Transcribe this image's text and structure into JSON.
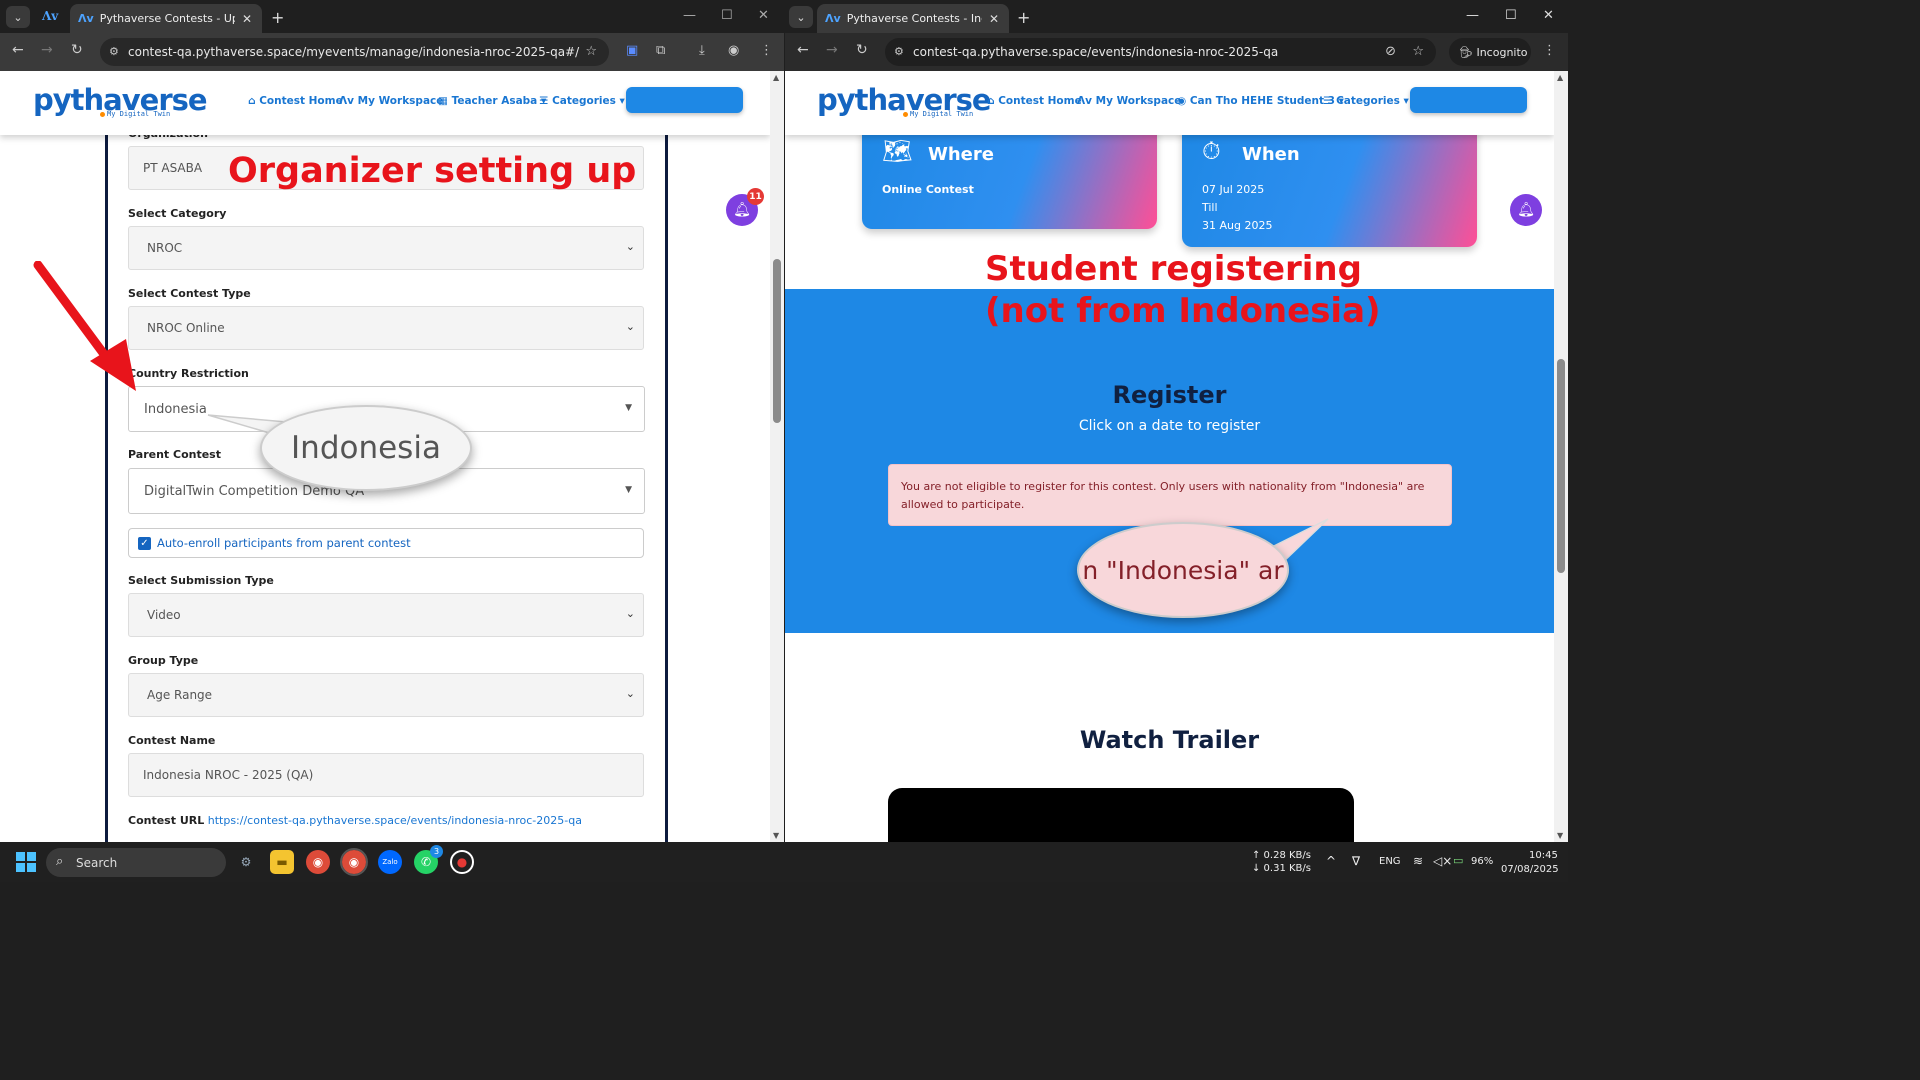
{
  "left_window": {
    "tab_title": "Pythaverse Contests - Update c",
    "url": "contest-qa.pythaverse.space/myevents/manage/indonesia-nroc-2025-qa#/",
    "header": {
      "logo": "pythaverse",
      "logo_sub": "My Digital Twin",
      "nav": [
        "Contest Home",
        "My Workspace",
        "Teacher Asaba",
        "Categories"
      ]
    },
    "notification_count": "11",
    "annotation_title": "Organizer setting up",
    "form": {
      "partial_top_label": "Organization",
      "organization_value": "PT ASABA",
      "category_label": "Select Category",
      "category_value": "NROC",
      "contest_type_label": "Select Contest Type",
      "contest_type_value": "NROC Online",
      "country_label": "Country Restriction",
      "country_value": "Indonesia",
      "country_zoom": "Indonesia",
      "parent_label": "Parent Contest",
      "parent_value": "DigitalTwin Competition Demo QA",
      "auto_enroll_label": "Auto-enroll participants from parent contest",
      "submission_label": "Select Submission Type",
      "submission_value": "Video",
      "group_label": "Group Type",
      "group_value": "Age Range",
      "name_label": "Contest Name",
      "name_value": "Indonesia NROC - 2025 (QA)",
      "url_label": "Contest URL",
      "url_value": "https://contest-qa.pythaverse.space/events/indonesia-nroc-2025-qa"
    }
  },
  "right_window": {
    "tab_title": "Pythaverse Contests - Indonesi",
    "url": "contest-qa.pythaverse.space/events/indonesia-nroc-2025-qa",
    "incognito_label": "Incognito",
    "header": {
      "logo": "pythaverse",
      "logo_sub": "My Digital Twin",
      "nav": [
        "Contest Home",
        "My Workspace",
        "Can Tho HEHE Student 3",
        "Categories"
      ]
    },
    "where_card": {
      "title": "Where",
      "value": "Online Contest"
    },
    "when_card": {
      "title": "When",
      "start": "07 Jul 2025",
      "till": "Till",
      "end": "31 Aug 2025"
    },
    "annotation_line1": "Student registering",
    "annotation_line2": "(not from Indonesia)",
    "register_title": "Register",
    "register_sub": "Click on a date to register",
    "alert_text": "You are not eligible to register for this contest. Only users with nationality from \"Indonesia\" are allowed to participate.",
    "alert_zoom": "n \"Indonesia\" ar",
    "trailer_title": "Watch Trailer"
  },
  "taskbar": {
    "search_placeholder": "Search",
    "net_up": "↑ 0.28 KB/s",
    "net_down": "↓ 0.31 KB/s",
    "lang": "ENG",
    "battery": "96%",
    "time": "10:45",
    "date": "07/08/2025",
    "whatsapp_badge": "3"
  },
  "colors": {
    "brand": "#1565c0",
    "accent_blue": "#1e88e5",
    "annotation_red": "#e8141b",
    "bell": "#7e3fe0"
  }
}
